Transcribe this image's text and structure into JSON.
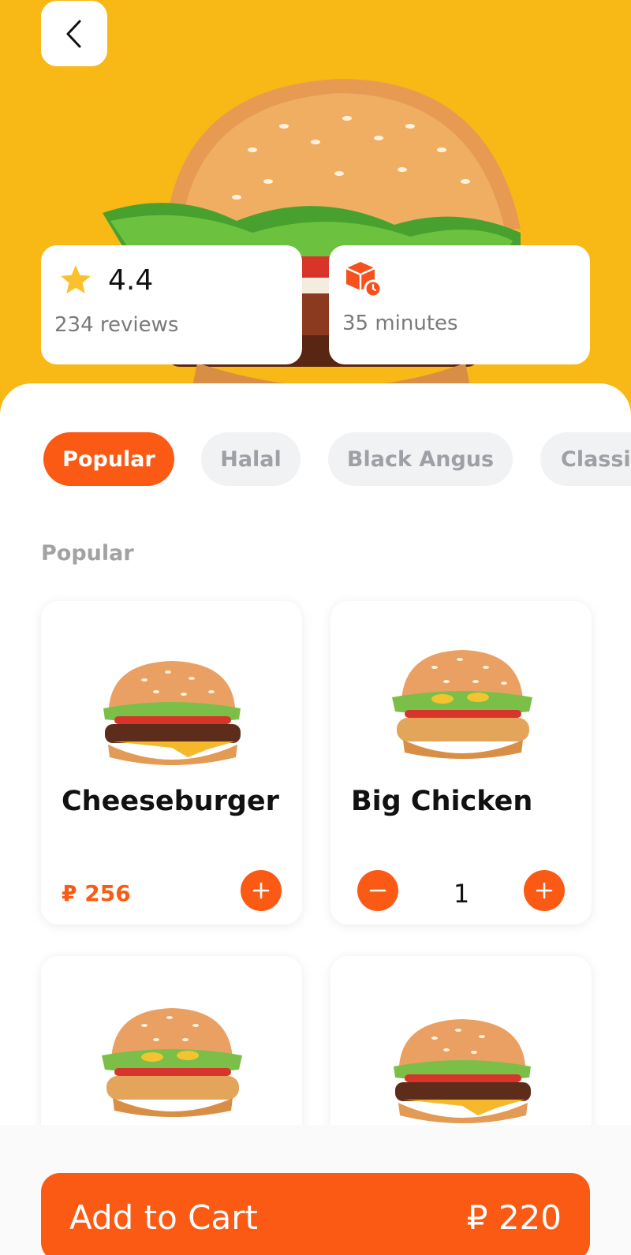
{
  "hero": {
    "back_icon": "chevron-left-icon",
    "rating": {
      "icon": "star-icon",
      "value": "4.4",
      "reviews": "234 reviews"
    },
    "delivery": {
      "icon": "box-clock-icon",
      "time": "35 minutes"
    }
  },
  "chips": [
    "Popular",
    "Halal",
    "Black Angus",
    "Classi"
  ],
  "section_title": "Popular",
  "products": [
    {
      "name": "Cheeseburger",
      "price": "₽ 256",
      "quantity": null
    },
    {
      "name": "Big Chicken",
      "price": null,
      "quantity": "1"
    },
    {
      "name": "",
      "price": null,
      "quantity": null
    },
    {
      "name": "",
      "price": null,
      "quantity": null
    }
  ],
  "cart": {
    "label": "Add to Cart",
    "total": "₽ 220"
  },
  "colors": {
    "hero_bg": "#f8b816",
    "accent": "#fa5a14",
    "chip_idle_bg": "#f1f2f4",
    "muted_text": "#7a7a7a"
  }
}
